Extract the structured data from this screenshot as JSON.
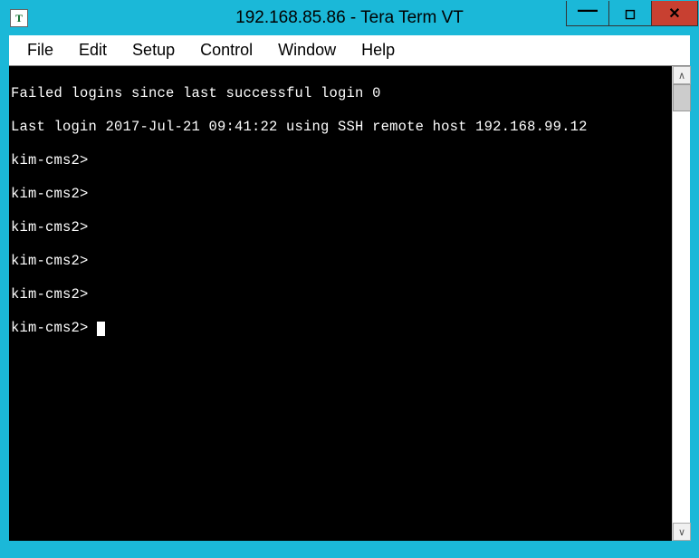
{
  "titlebar": {
    "icon_letter": "T",
    "title": "192.168.85.86 - Tera Term VT"
  },
  "window_controls": {
    "minimize": "—",
    "maximize": "◻",
    "close": "✕"
  },
  "menu": {
    "file": "File",
    "edit": "Edit",
    "setup": "Setup",
    "control": "Control",
    "window": "Window",
    "help": "Help"
  },
  "terminal": {
    "lines": [
      "Failed logins since last successful login 0",
      "Last login 2017-Jul-21 09:41:22 using SSH remote host 192.168.99.12",
      "kim-cms2>",
      "kim-cms2>",
      "kim-cms2>",
      "kim-cms2>",
      "kim-cms2>"
    ],
    "prompt": "kim-cms2> "
  },
  "scrollbar": {
    "up": "∧",
    "down": "∨"
  }
}
